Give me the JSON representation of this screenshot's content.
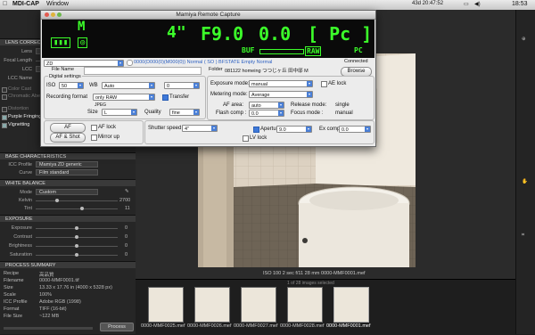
{
  "menubar": {
    "app": "MDI-CAP",
    "window": "Window",
    "status": "43d 20:47:52",
    "clock": "18:53"
  },
  "left": {
    "lens_header": "LENS CORRECTI...",
    "rows": [
      "Lens",
      "Focal Length",
      "LCC",
      "LCC Name",
      "Color Cast",
      "Chromatic Aberration",
      "Distortion",
      "Purple Fringing",
      "Vignetting"
    ],
    "base_header": "BASE CHARACTERISTICS",
    "icc_label": "ICC Profile",
    "icc_value": "Mamiya ZD generic",
    "curve_label": "Curve",
    "curve_value": "Film standard",
    "wb_header": "WHITE BALANCE",
    "mode_label": "Mode",
    "mode_value": "Custom",
    "kelvin_label": "Kelvin",
    "kelvin_value": "2700",
    "tint_label": "Tint",
    "tint_value": "11",
    "exposure_header": "EXPOSURE",
    "exposure_rows": [
      "Exposure",
      "Contrast",
      "Brightness",
      "Saturation"
    ],
    "exposure_values": [
      "0",
      "0",
      "0",
      "0"
    ],
    "process_header": "PROCESS SUMMARY",
    "summary": [
      {
        "k": "Recipe",
        "v": "高品質"
      },
      {
        "k": "Filename",
        "v": "0000-MMF0001.tif"
      },
      {
        "k": "Size",
        "v": "13.33 x 17.76 in (4000 x 5328 px)"
      },
      {
        "k": "Scale",
        "v": "100%"
      },
      {
        "k": "ICC Profile",
        "v": "Adobe RGB (1998)"
      },
      {
        "k": "Format",
        "v": "TIFF (16-bit)"
      },
      {
        "k": "File Size",
        "v": "~122 MB"
      }
    ],
    "process_button": "Process"
  },
  "viewer": {
    "caption": "ISO 100  2 sec  f/11  28 mm  0000-MMF0001.mef"
  },
  "filmstrip": {
    "header": "1 of 28 images selected",
    "items": [
      "0000-MMF0025.mef",
      "0000-MMF0026.mef",
      "0000-MMF0027.mef",
      "0000-MMF0028.mef",
      "0000-MMF0001.mef"
    ]
  },
  "dialog": {
    "title": "Mamiya Remote Capture",
    "lcd": {
      "mode": "M",
      "shutter": "4\"",
      "aperture": "F9.0",
      "ev": "0.0",
      "pc_bracket": "[ Pc ]",
      "buf": "BUF",
      "raw": "RAW",
      "pc": "PC"
    },
    "camera_value": "ZD",
    "status_line": "0000(D000(0)(M000(0))    Normal ( SO )   BFSTATE Empty      Normal",
    "connected": "Connected",
    "file_name_label": "File Name",
    "folder_label": "Folder",
    "folder_value": "081122 homeing つつじヶ丘 田中邸 M",
    "browse": "Browse",
    "digital_settings": "Digital settings",
    "iso_label": "ISO",
    "iso_value": "50",
    "wb_label": "WB",
    "wb_value": "Auto",
    "wb_comp": "0",
    "recording_label": "Recording format",
    "recording_value": "only RAW",
    "transfer": "Transfer",
    "jpeg_label": "JPEG",
    "size_label": "Size",
    "size_value": "L",
    "quality_label": "Quality",
    "quality_value": "fine",
    "af_btn": "AF",
    "af_shot_btn": "AF & Shot",
    "af_lock": "AF lock",
    "mirror_up": "Mirror up",
    "exposure_mode_label": "Exposure mode:",
    "exposure_mode_value": "manual",
    "ae_lock": "AE lock",
    "metering_label": "Metering mode:",
    "metering_value": "Average",
    "af_area_label": "AF area:",
    "af_area_value": "auto",
    "flash_label": "Flash comp :",
    "flash_value": "0.0",
    "release_label": "Release mode:",
    "release_value": "single",
    "focus_label": "Focus mode :",
    "focus_value": "manual",
    "shutter_label": "Shutter speed",
    "shutter_value": "4\"",
    "lv_lock": "LV lock",
    "aperture_label": "Aperture",
    "aperture_value": "9.0",
    "excomp_label": "Ex comp",
    "excomp_value": "0.0"
  }
}
